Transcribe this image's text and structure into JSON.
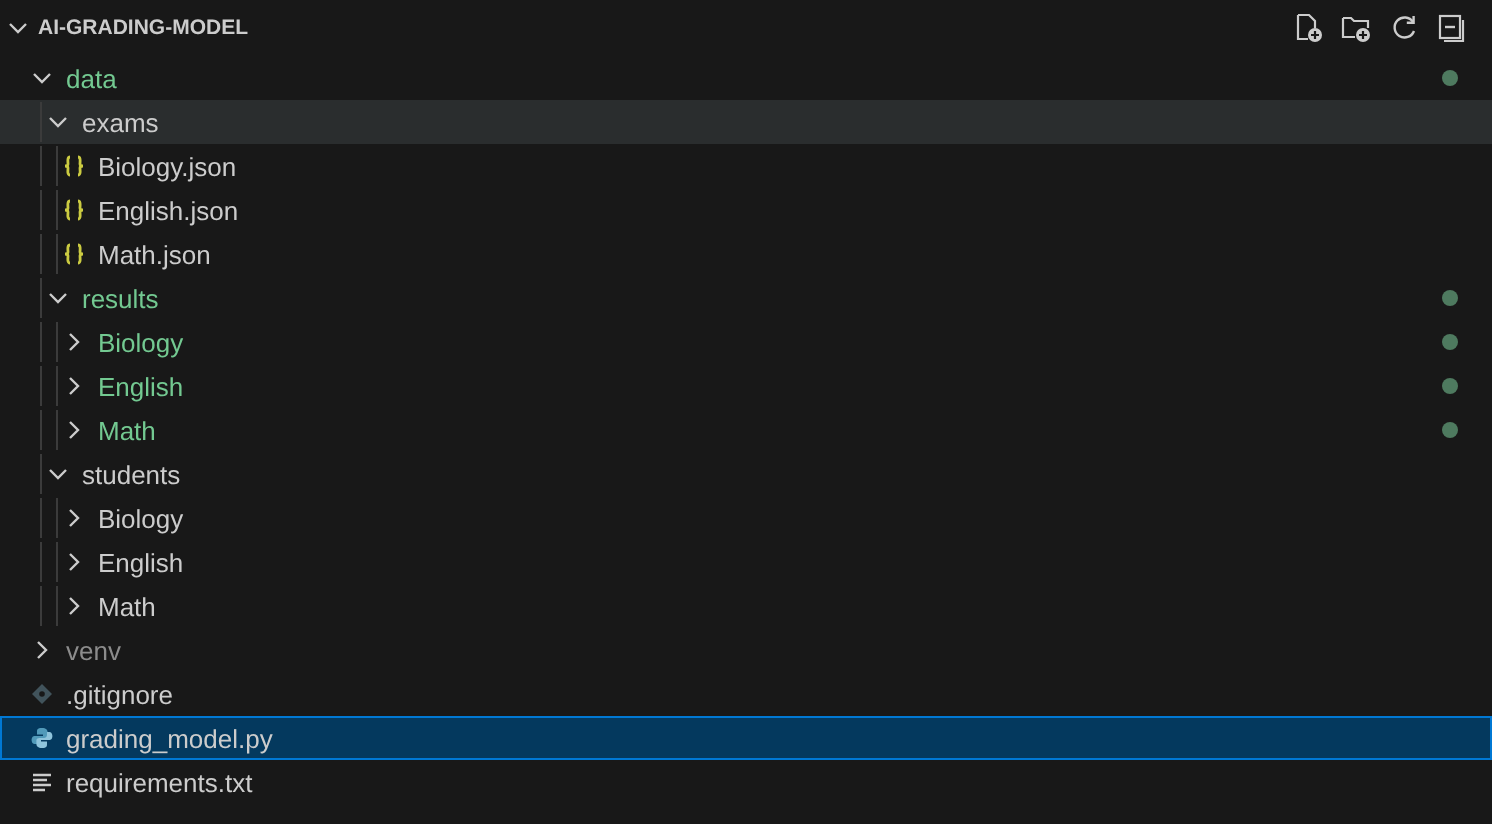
{
  "explorer": {
    "title": "AI-GRADING-MODEL",
    "expanded": true,
    "tree": [
      {
        "kind": "folder",
        "label": "data",
        "expanded": true,
        "modified": true,
        "ignored": false,
        "selected": false,
        "hovered": false,
        "children": [
          {
            "kind": "folder",
            "label": "exams",
            "expanded": true,
            "modified": false,
            "ignored": false,
            "selected": false,
            "hovered": true,
            "children": [
              {
                "kind": "json",
                "label": "Biology.json",
                "modified": false,
                "ignored": false,
                "selected": false,
                "hovered": false
              },
              {
                "kind": "json",
                "label": "English.json",
                "modified": false,
                "ignored": false,
                "selected": false,
                "hovered": false
              },
              {
                "kind": "json",
                "label": "Math.json",
                "modified": false,
                "ignored": false,
                "selected": false,
                "hovered": false
              }
            ]
          },
          {
            "kind": "folder",
            "label": "results",
            "expanded": true,
            "modified": true,
            "ignored": false,
            "selected": false,
            "hovered": false,
            "children": [
              {
                "kind": "folder",
                "label": "Biology",
                "expanded": false,
                "modified": true,
                "ignored": false,
                "selected": false,
                "hovered": false
              },
              {
                "kind": "folder",
                "label": "English",
                "expanded": false,
                "modified": true,
                "ignored": false,
                "selected": false,
                "hovered": false
              },
              {
                "kind": "folder",
                "label": "Math",
                "expanded": false,
                "modified": true,
                "ignored": false,
                "selected": false,
                "hovered": false
              }
            ]
          },
          {
            "kind": "folder",
            "label": "students",
            "expanded": true,
            "modified": false,
            "ignored": false,
            "selected": false,
            "hovered": false,
            "children": [
              {
                "kind": "folder",
                "label": "Biology",
                "expanded": false,
                "modified": false,
                "ignored": false,
                "selected": false,
                "hovered": false
              },
              {
                "kind": "folder",
                "label": "English",
                "expanded": false,
                "modified": false,
                "ignored": false,
                "selected": false,
                "hovered": false
              },
              {
                "kind": "folder",
                "label": "Math",
                "expanded": false,
                "modified": false,
                "ignored": false,
                "selected": false,
                "hovered": false
              }
            ]
          }
        ]
      },
      {
        "kind": "folder",
        "label": "venv",
        "expanded": false,
        "modified": false,
        "ignored": true,
        "selected": false,
        "hovered": false
      },
      {
        "kind": "gitignore",
        "label": ".gitignore",
        "modified": false,
        "ignored": false,
        "selected": false,
        "hovered": false
      },
      {
        "kind": "python",
        "label": "grading_model.py",
        "modified": false,
        "ignored": false,
        "selected": true,
        "hovered": false
      },
      {
        "kind": "text",
        "label": "requirements.txt",
        "modified": false,
        "ignored": false,
        "selected": false,
        "hovered": false
      }
    ]
  }
}
